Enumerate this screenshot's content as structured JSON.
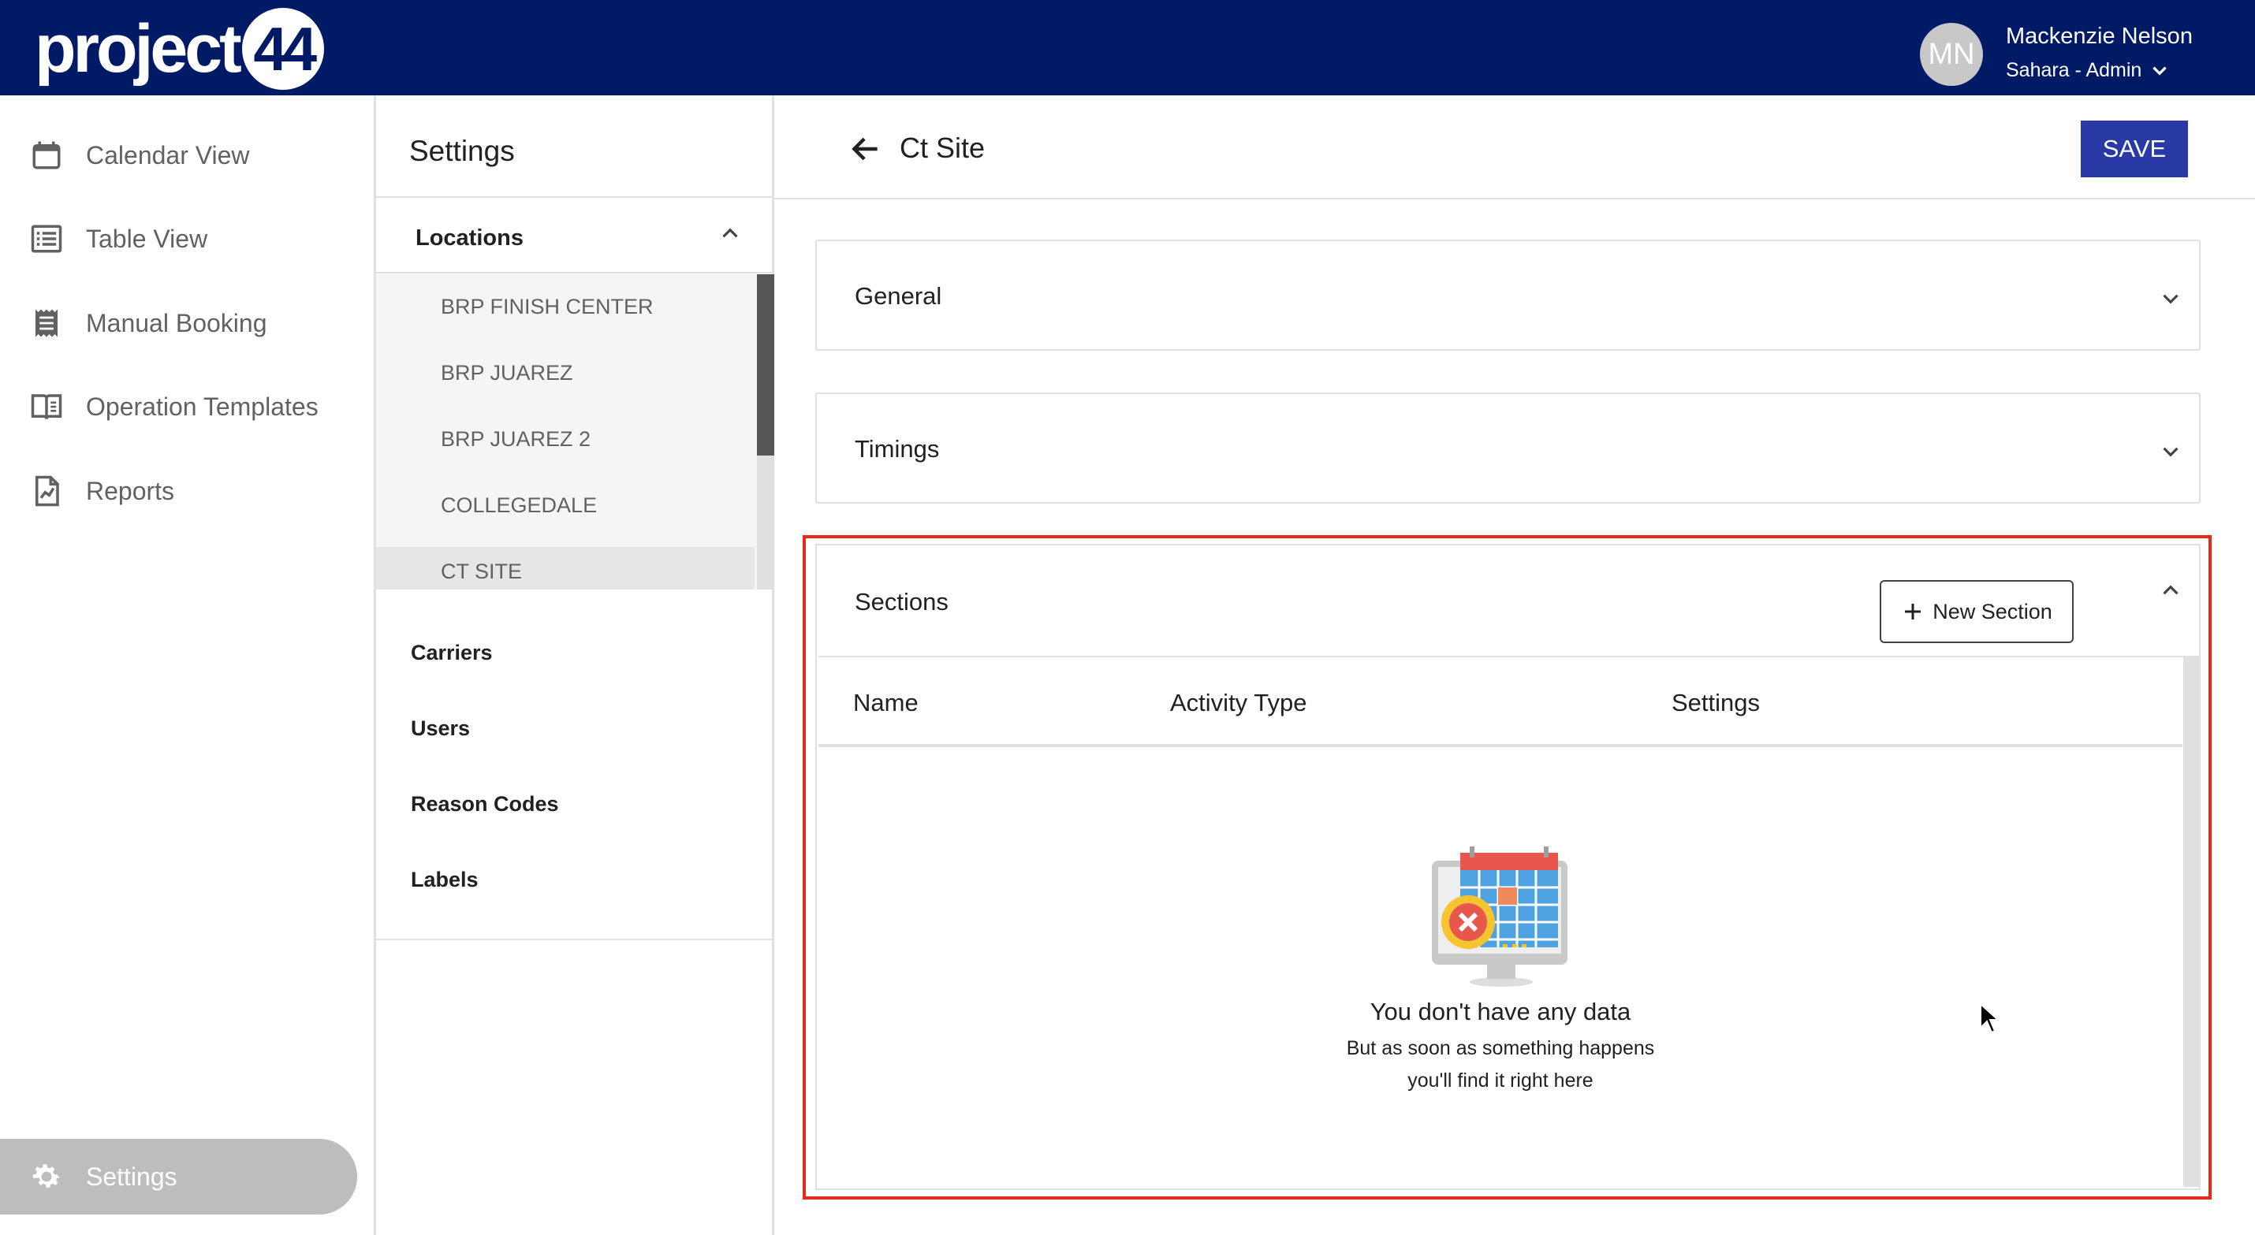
{
  "header": {
    "logo_text": "project",
    "logo_badge": "44",
    "avatar_initials": "MN",
    "user_name": "Mackenzie Nelson",
    "user_role": "Sahara - Admin"
  },
  "nav": {
    "items": [
      {
        "label": "Calendar View",
        "icon": "calendar-icon"
      },
      {
        "label": "Table View",
        "icon": "list-icon"
      },
      {
        "label": "Manual Booking",
        "icon": "receipt-icon"
      },
      {
        "label": "Operation Templates",
        "icon": "book-icon"
      },
      {
        "label": "Reports",
        "icon": "report-icon"
      }
    ],
    "settings_label": "Settings"
  },
  "settings_panel": {
    "title": "Settings",
    "locations_label": "Locations",
    "locations": [
      "BRP FINISH CENTER",
      "BRP JUAREZ",
      "BRP JUAREZ 2",
      "COLLEGEDALE",
      "CT SITE"
    ],
    "selected_location": "CT SITE",
    "links": [
      "Carriers",
      "Users",
      "Reason Codes",
      "Labels"
    ]
  },
  "main": {
    "title": "Ct Site",
    "save_label": "SAVE",
    "cards": {
      "general": "General",
      "timings": "Timings",
      "sections": "Sections"
    },
    "new_section_label": "New Section",
    "table": {
      "columns": [
        "Name",
        "Activity Type",
        "Settings"
      ]
    },
    "empty_state": {
      "title": "You don't have any data",
      "line1": "But as soon as something happens",
      "line2": "you'll find it right here"
    }
  },
  "colors": {
    "header_bg": "#001a66",
    "save_button": "#2939a6",
    "highlight_border": "#e8291c",
    "active_nav_bg": "#bdbdbd"
  }
}
